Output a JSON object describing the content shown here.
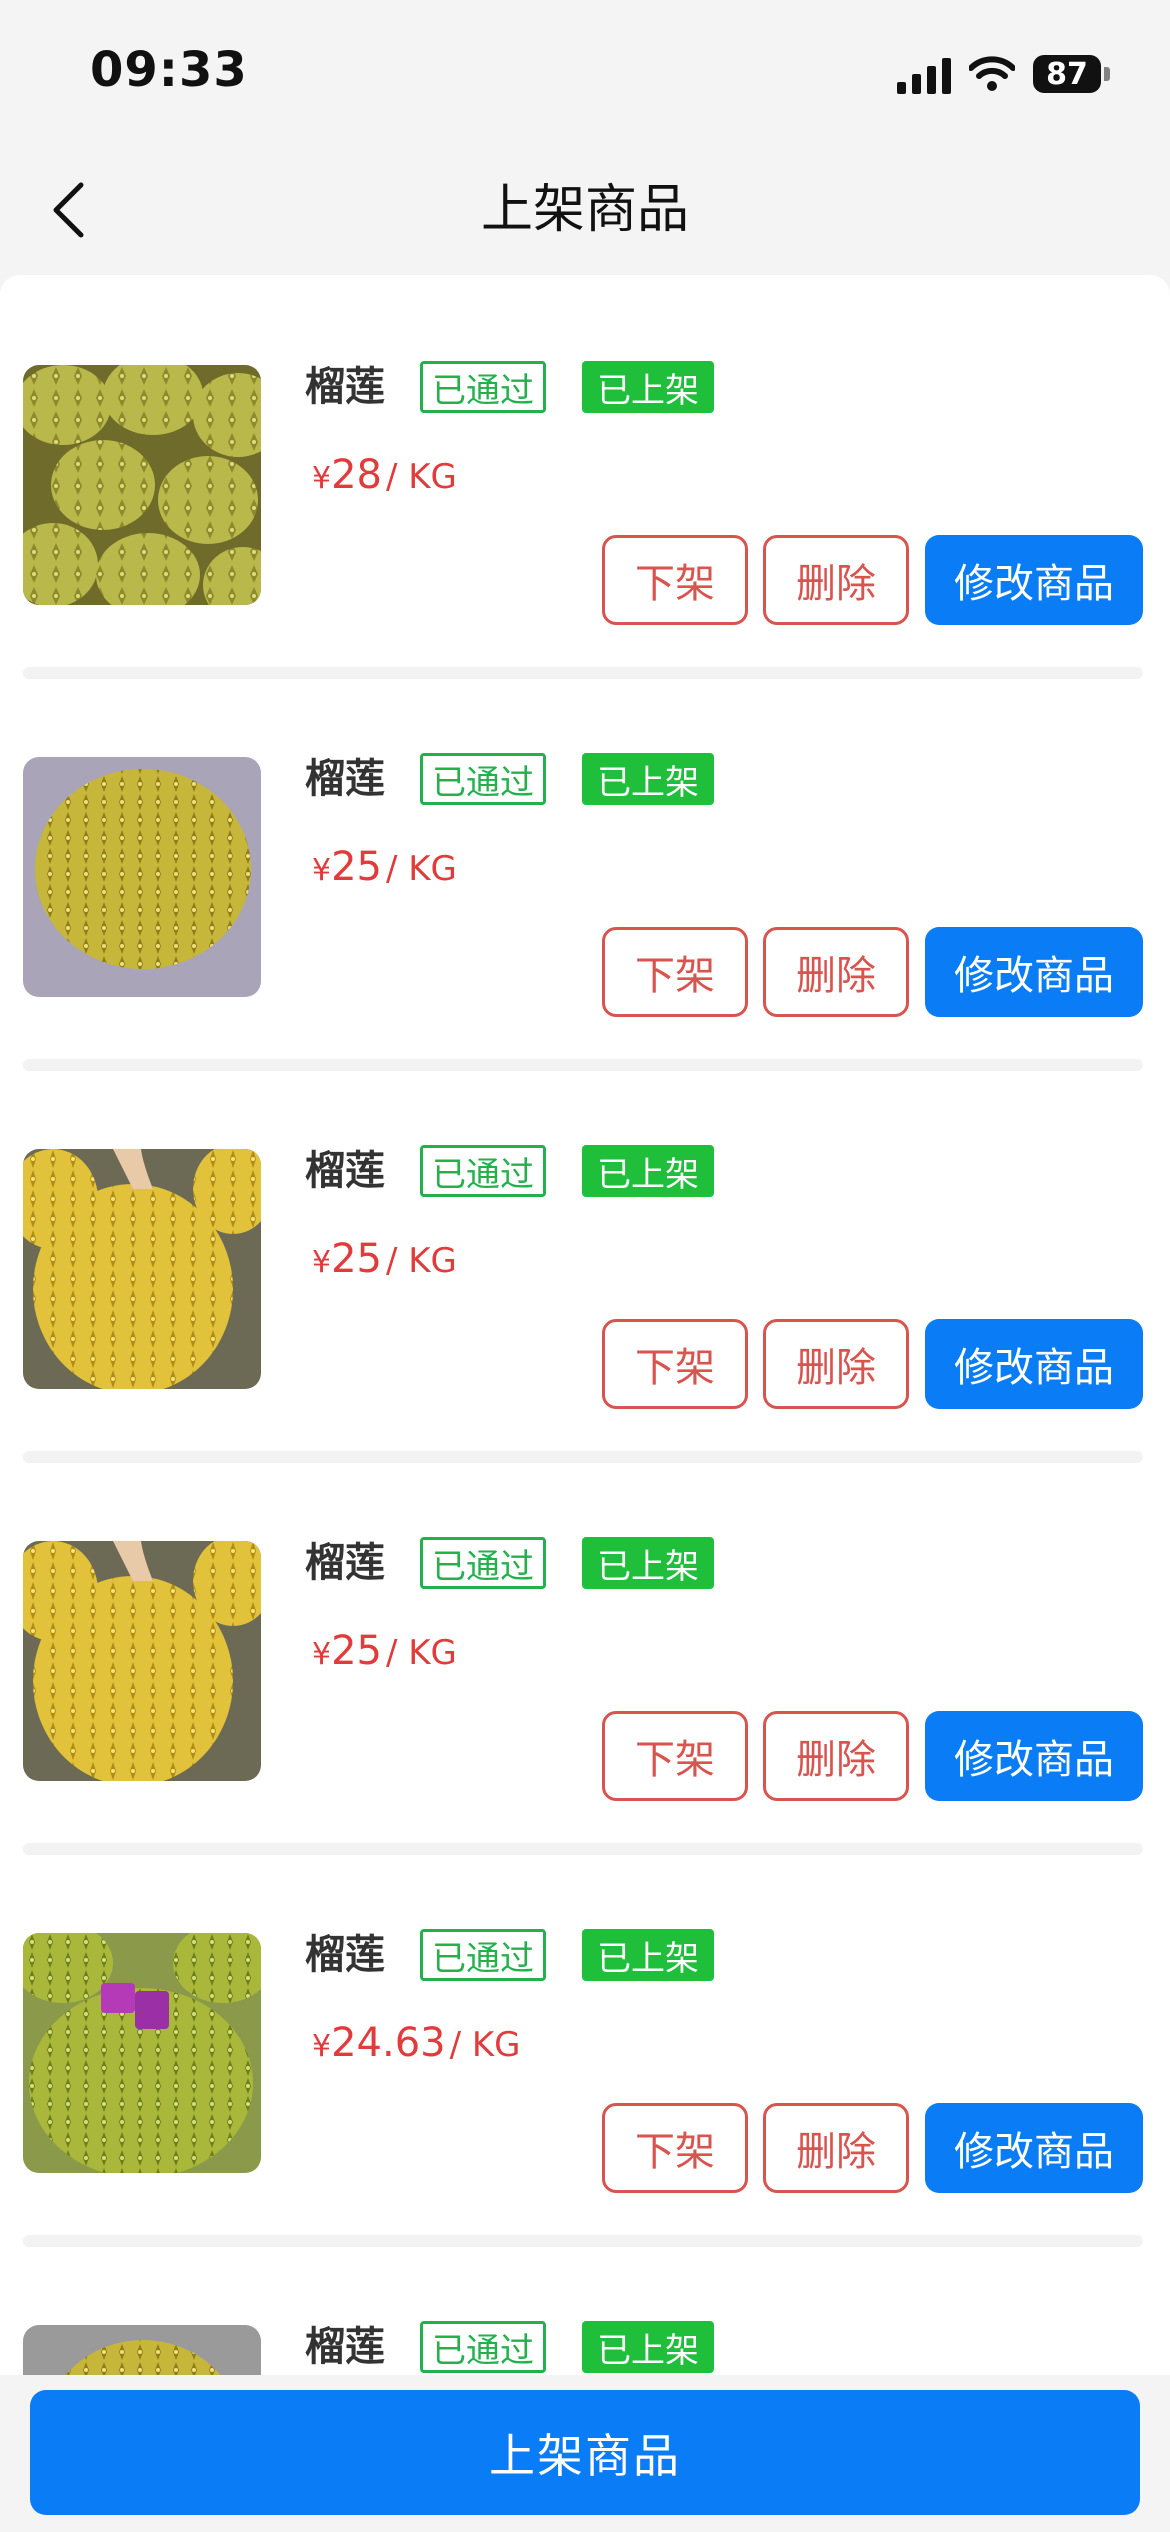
{
  "status_bar": {
    "time": "09:33",
    "battery": "87"
  },
  "header": {
    "title": "上架商品",
    "back_icon": "chevron-left-icon"
  },
  "items": [
    {
      "name": "榴莲",
      "review_badge": "已通过",
      "shelf_badge": "已上架",
      "currency": "¥",
      "price": "28",
      "unit": "/ KG",
      "actions": {
        "unlist": "下架",
        "delete": "删除",
        "edit": "修改商品"
      }
    },
    {
      "name": "榴莲",
      "review_badge": "已通过",
      "shelf_badge": "已上架",
      "currency": "¥",
      "price": "25",
      "unit": "/ KG",
      "actions": {
        "unlist": "下架",
        "delete": "删除",
        "edit": "修改商品"
      }
    },
    {
      "name": "榴莲",
      "review_badge": "已通过",
      "shelf_badge": "已上架",
      "currency": "¥",
      "price": "25",
      "unit": "/ KG",
      "actions": {
        "unlist": "下架",
        "delete": "删除",
        "edit": "修改商品"
      }
    },
    {
      "name": "榴莲",
      "review_badge": "已通过",
      "shelf_badge": "已上架",
      "currency": "¥",
      "price": "25",
      "unit": "/ KG",
      "actions": {
        "unlist": "下架",
        "delete": "删除",
        "edit": "修改商品"
      }
    },
    {
      "name": "榴莲",
      "review_badge": "已通过",
      "shelf_badge": "已上架",
      "currency": "¥",
      "price": "24.63",
      "unit": "/ KG",
      "actions": {
        "unlist": "下架",
        "delete": "删除",
        "edit": "修改商品"
      }
    },
    {
      "name": "榴莲",
      "review_badge": "已通过",
      "shelf_badge": "已上架"
    }
  ],
  "footer": {
    "button_label": "上架商品"
  },
  "colors": {
    "primary": "#0a7cf5",
    "success": "#22b14c",
    "danger": "#d9534f",
    "price": "#e03c3c"
  }
}
